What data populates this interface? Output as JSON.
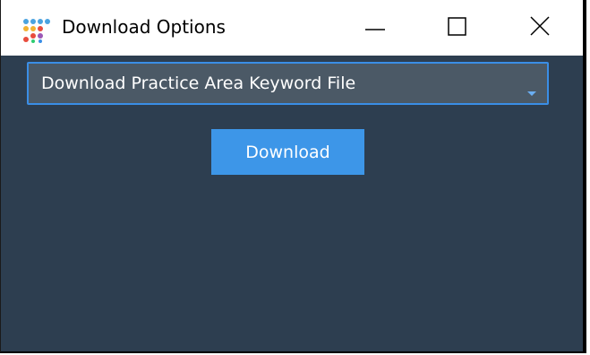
{
  "window": {
    "title": "Download Options",
    "icon": "app-grid-dots-icon",
    "controls": [
      "minimize-icon",
      "maximize-icon",
      "close-icon"
    ]
  },
  "dropdown": {
    "selected": "Download Practice Area Keyword File"
  },
  "actions": {
    "download_label": "Download"
  },
  "colors": {
    "client_bg": "#2d3e50",
    "dropdown_bg": "#4b5966",
    "dropdown_border": "#3a8ee6",
    "button_bg": "#3d96e8",
    "text": "#ffffff"
  }
}
